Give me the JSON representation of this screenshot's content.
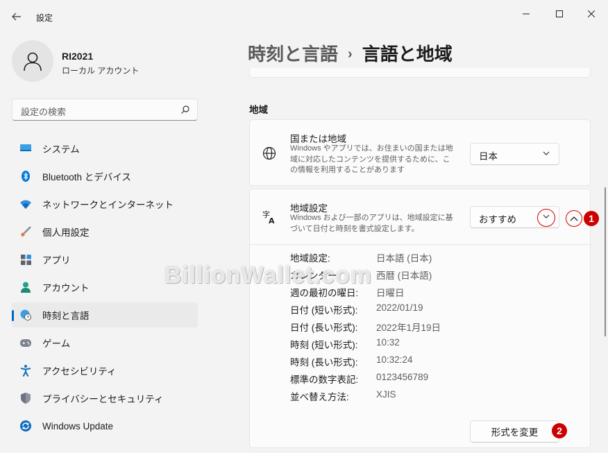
{
  "window": {
    "title": "設定",
    "back_icon": "arrow-left-icon",
    "minimize_icon": "minimize-icon",
    "maximize_icon": "maximize-icon",
    "close_icon": "close-icon"
  },
  "profile": {
    "name": "RI2021",
    "account_type": "ローカル アカウント"
  },
  "search": {
    "placeholder": "設定の検索"
  },
  "sidebar": {
    "items": [
      {
        "label": "システム",
        "icon": "monitor-icon",
        "active": false
      },
      {
        "label": "Bluetooth とデバイス",
        "icon": "bluetooth-icon",
        "active": false
      },
      {
        "label": "ネットワークとインターネット",
        "icon": "wifi-icon",
        "active": false
      },
      {
        "label": "個人用設定",
        "icon": "brush-icon",
        "active": false
      },
      {
        "label": "アプリ",
        "icon": "apps-icon",
        "active": false
      },
      {
        "label": "アカウント",
        "icon": "person-icon",
        "active": false
      },
      {
        "label": "時刻と言語",
        "icon": "globe-clock-icon",
        "active": true
      },
      {
        "label": "ゲーム",
        "icon": "gamepad-icon",
        "active": false
      },
      {
        "label": "アクセシビリティ",
        "icon": "accessibility-icon",
        "active": false
      },
      {
        "label": "プライバシーとセキュリティ",
        "icon": "shield-icon",
        "active": false
      },
      {
        "label": "Windows Update",
        "icon": "update-icon",
        "active": false
      }
    ]
  },
  "breadcrumb": {
    "parent": "時刻と言語",
    "separator": "›",
    "current": "言語と地域"
  },
  "section": {
    "title": "地域"
  },
  "region_card": {
    "title": "国または地域",
    "description": "Windows やアプリでは、お住まいの国または地域に対応したコンテンツを提供するために、この情報を利用することがあります",
    "selected": "日本"
  },
  "format_card": {
    "title": "地域設定",
    "description": "Windows および一部のアプリは、地域設定に基づいて日付と時刻を書式設定します。",
    "selected": "おすすめ",
    "details": [
      {
        "label": "地域設定:",
        "value": "日本語 (日本)"
      },
      {
        "label": "カレンダー:",
        "value": "西暦 (日本語)"
      },
      {
        "label": "週の最初の曜日:",
        "value": "日曜日"
      },
      {
        "label": "日付 (短い形式):",
        "value": "2022/01/19"
      },
      {
        "label": "日付 (長い形式):",
        "value": "2022年1月19日"
      },
      {
        "label": "時刻 (短い形式):",
        "value": "10:32"
      },
      {
        "label": "時刻 (長い形式):",
        "value": "10:32:24"
      },
      {
        "label": "標準の数字表記:",
        "value": "0123456789"
      },
      {
        "label": "並べ替え方法:",
        "value": "XJIS"
      }
    ],
    "change_button": "形式を変更"
  },
  "annotations": {
    "badge1": "1",
    "badge2": "2",
    "color": "#cc0000"
  },
  "watermark": "BillionWallet.com",
  "colors": {
    "accent": "#0067c0",
    "background": "#f3f3f3",
    "card": "#fbfbfb"
  }
}
